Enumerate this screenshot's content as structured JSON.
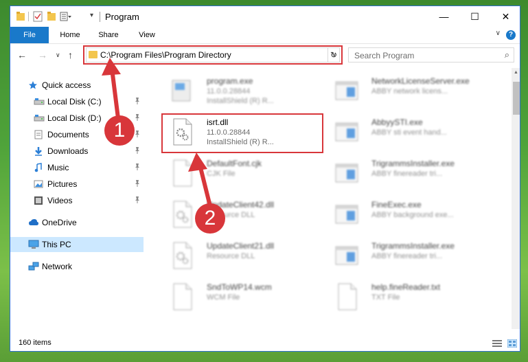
{
  "window": {
    "title": "Program",
    "minimize": "—",
    "maximize": "☐",
    "close": "✕"
  },
  "ribbon": {
    "tabs": [
      "File",
      "Home",
      "Share",
      "View"
    ],
    "help": "?",
    "collapse": "∨"
  },
  "nav": {
    "back": "←",
    "forward": "→",
    "recent": "∨",
    "up": "↑",
    "address": "C:\\Program Files\\Program Directory",
    "address_dropdown": "∨",
    "refresh": "↻",
    "search_placeholder": "Search Program",
    "search_glyph": "⌕"
  },
  "sidebar": {
    "items": [
      {
        "label": "Quick access",
        "icon": "star-icon",
        "pinned": false
      },
      {
        "label": "Local Disk (C:)",
        "icon": "drive-icon",
        "pinned": true
      },
      {
        "label": "Local Disk (D:)",
        "icon": "drive-icon",
        "pinned": true
      },
      {
        "label": "Documents",
        "icon": "documents-icon",
        "pinned": true
      },
      {
        "label": "Downloads",
        "icon": "download-arrow-icon",
        "pinned": true
      },
      {
        "label": "Music",
        "icon": "music-note-icon",
        "pinned": true
      },
      {
        "label": "Pictures",
        "icon": "pictures-icon",
        "pinned": true
      },
      {
        "label": "Videos",
        "icon": "film-icon",
        "pinned": true
      },
      {
        "label": "OneDrive",
        "icon": "cloud-icon",
        "pinned": false
      },
      {
        "label": "This PC",
        "icon": "monitor-icon",
        "pinned": false
      },
      {
        "label": "Network",
        "icon": "network-icon",
        "pinned": false
      }
    ],
    "pin_glyph": "📌"
  },
  "files": [
    {
      "name": "program.exe",
      "line2": "11.0.0.28844",
      "line3": "InstallShield (R) R...",
      "kind": "exe",
      "blurred": true
    },
    {
      "name": "NetworkLicenseServer.exe",
      "line2": "ABBY network licens...",
      "line3": "",
      "kind": "app",
      "blurred": true
    },
    {
      "name": "isrt.dll",
      "line2": "11.0.0.28844",
      "line3": "InstallShield (R) R...",
      "kind": "dll",
      "blurred": false
    },
    {
      "name": "AbbyySTI.exe",
      "line2": "ABBY sti event hand...",
      "line3": "",
      "kind": "app",
      "blurred": true
    },
    {
      "name": "DefaultFont.cjk",
      "line2": "CJK File",
      "line3": "",
      "kind": "blank",
      "blurred": true
    },
    {
      "name": "TrigrammsInstaller.exe",
      "line2": "ABBY finereader tri...",
      "line3": "",
      "kind": "app",
      "blurred": true
    },
    {
      "name": "UpdateClient42.dll",
      "line2": "Resource DLL",
      "line3": "",
      "kind": "dll",
      "blurred": true
    },
    {
      "name": "FineExec.exe",
      "line2": "ABBY background exe...",
      "line3": "",
      "kind": "app",
      "blurred": true
    },
    {
      "name": "UpdateClient21.dll",
      "line2": "Resource DLL",
      "line3": "",
      "kind": "dll",
      "blurred": true
    },
    {
      "name": "TrigrammsInstaller.exe",
      "line2": "ABBY finereader tri...",
      "line3": "",
      "kind": "app",
      "blurred": true
    },
    {
      "name": "SndToWP14.wcm",
      "line2": "WCM File",
      "line3": "",
      "kind": "blank",
      "blurred": true
    },
    {
      "name": "help.fineReader.txt",
      "line2": "TXT File",
      "line3": "",
      "kind": "blank",
      "blurred": true
    }
  ],
  "status": {
    "count": "160 items"
  },
  "callouts": [
    "1",
    "2"
  ],
  "colors": {
    "accent": "#1979ca",
    "highlight": "#d8363a",
    "selection": "#cce8ff"
  }
}
